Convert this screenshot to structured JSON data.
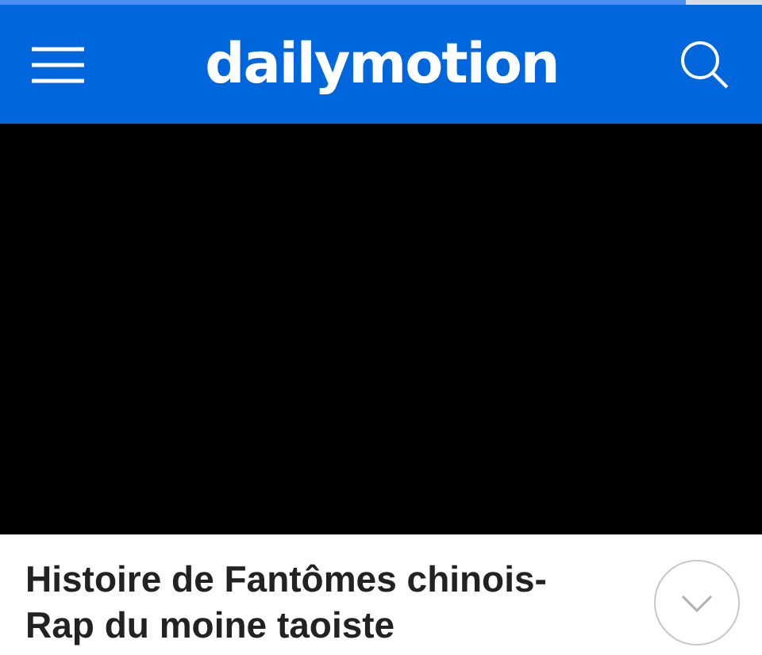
{
  "loading_bar": {
    "level": 0.9
  },
  "header": {
    "logo": "dailymotion"
  },
  "video": {
    "title": "Histoire de Fantômes chinois-Rap du moine taoiste",
    "details_expanded": false
  }
}
